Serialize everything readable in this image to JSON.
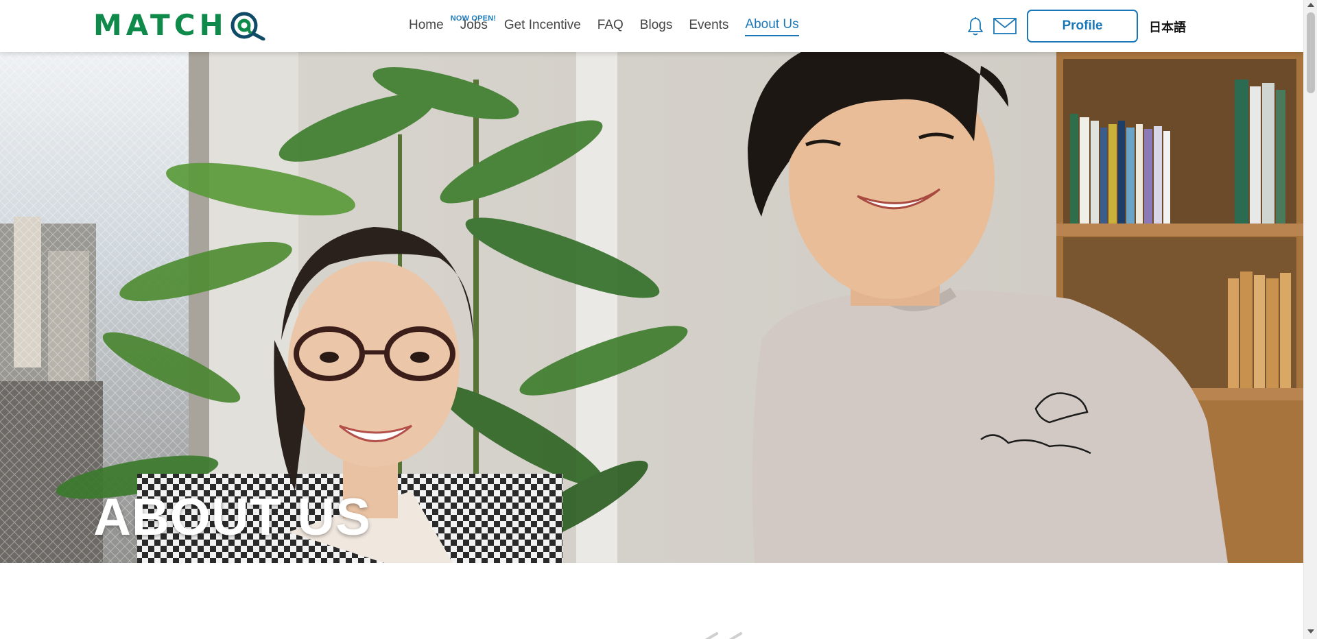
{
  "header": {
    "logo_text": "MATCH",
    "nav": [
      {
        "label": "Home",
        "badge": ""
      },
      {
        "label": "Jobs",
        "badge": "NOW OPEN!"
      },
      {
        "label": "Get Incentive",
        "badge": ""
      },
      {
        "label": "FAQ",
        "badge": ""
      },
      {
        "label": "Blogs",
        "badge": ""
      },
      {
        "label": "Events",
        "badge": ""
      },
      {
        "label": "About Us",
        "badge": "",
        "active": true
      }
    ],
    "profile_label": "Profile",
    "language_label": "日本語",
    "icons": [
      "bell-icon",
      "mail-icon"
    ]
  },
  "hero": {
    "title": "ABOUT US"
  },
  "colors": {
    "brand_green": "#0f8a4a",
    "accent_blue": "#1b78b8"
  }
}
